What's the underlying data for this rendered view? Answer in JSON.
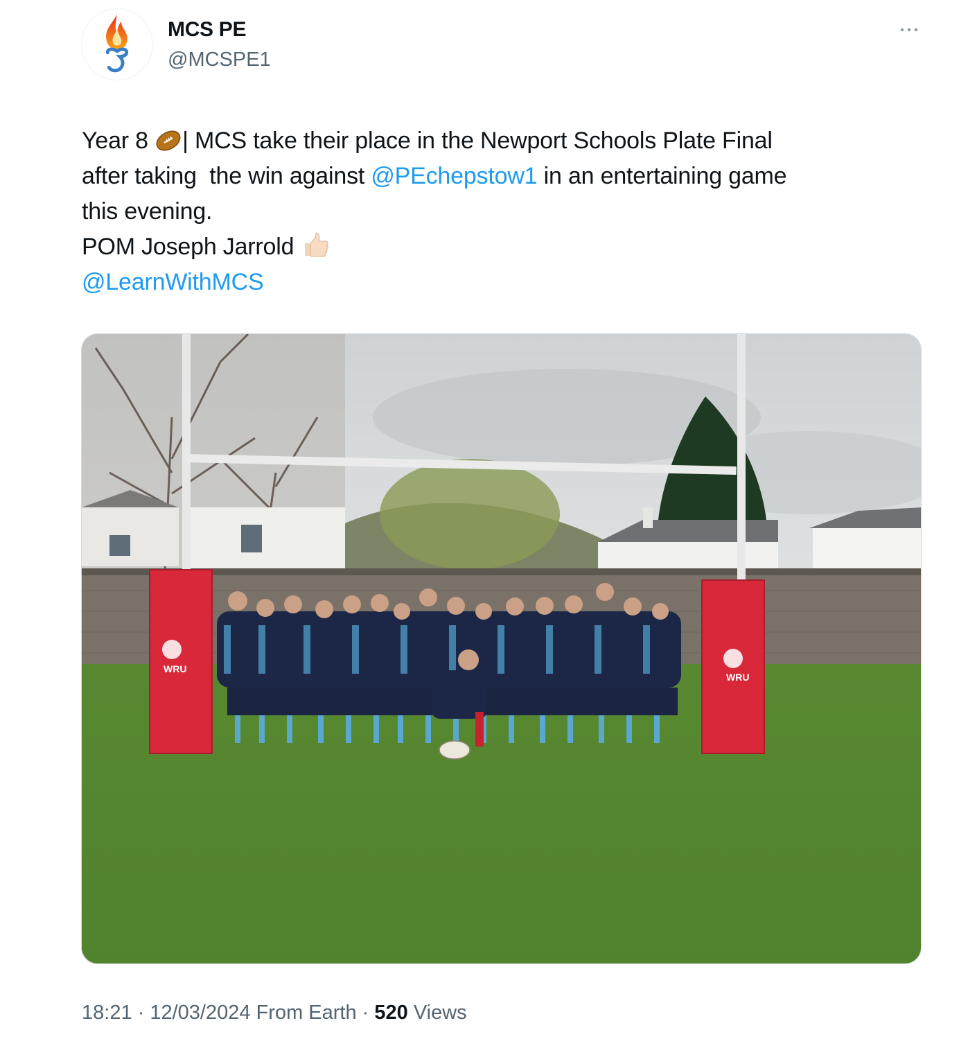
{
  "author": {
    "display_name": "MCS PE",
    "handle": "@MCSPE1",
    "avatar_icon": "flame-logo-icon"
  },
  "more_icon": "ellipsis-icon",
  "tweet": {
    "line1_prefix": "Year 8 ",
    "line1_emoji": "rugby-ball-emoji",
    "line1_rest": "| MCS take their place in the Newport Schools Plate Final",
    "line2_prefix": "after taking  the win against ",
    "line2_mention": "@PEchepstow1",
    "line2_rest": " in an entertaining game",
    "line3": "this evening.",
    "line4_text": "POM Joseph Jarrold ",
    "line4_emoji": "thumbs-up-emoji",
    "line5_mention": "@LearnWithMCS"
  },
  "media": {
    "type": "photo",
    "pad_text": "WRU"
  },
  "meta": {
    "time": "18:21",
    "separator": " · ",
    "date": "12/03/2024",
    "source": " From Earth",
    "views_count": "520",
    "views_label": " Views"
  },
  "colors": {
    "link": "#1d9bf0",
    "secondary_text": "#536471",
    "primary_text": "#0f1419",
    "pad_red": "#d8283a"
  }
}
